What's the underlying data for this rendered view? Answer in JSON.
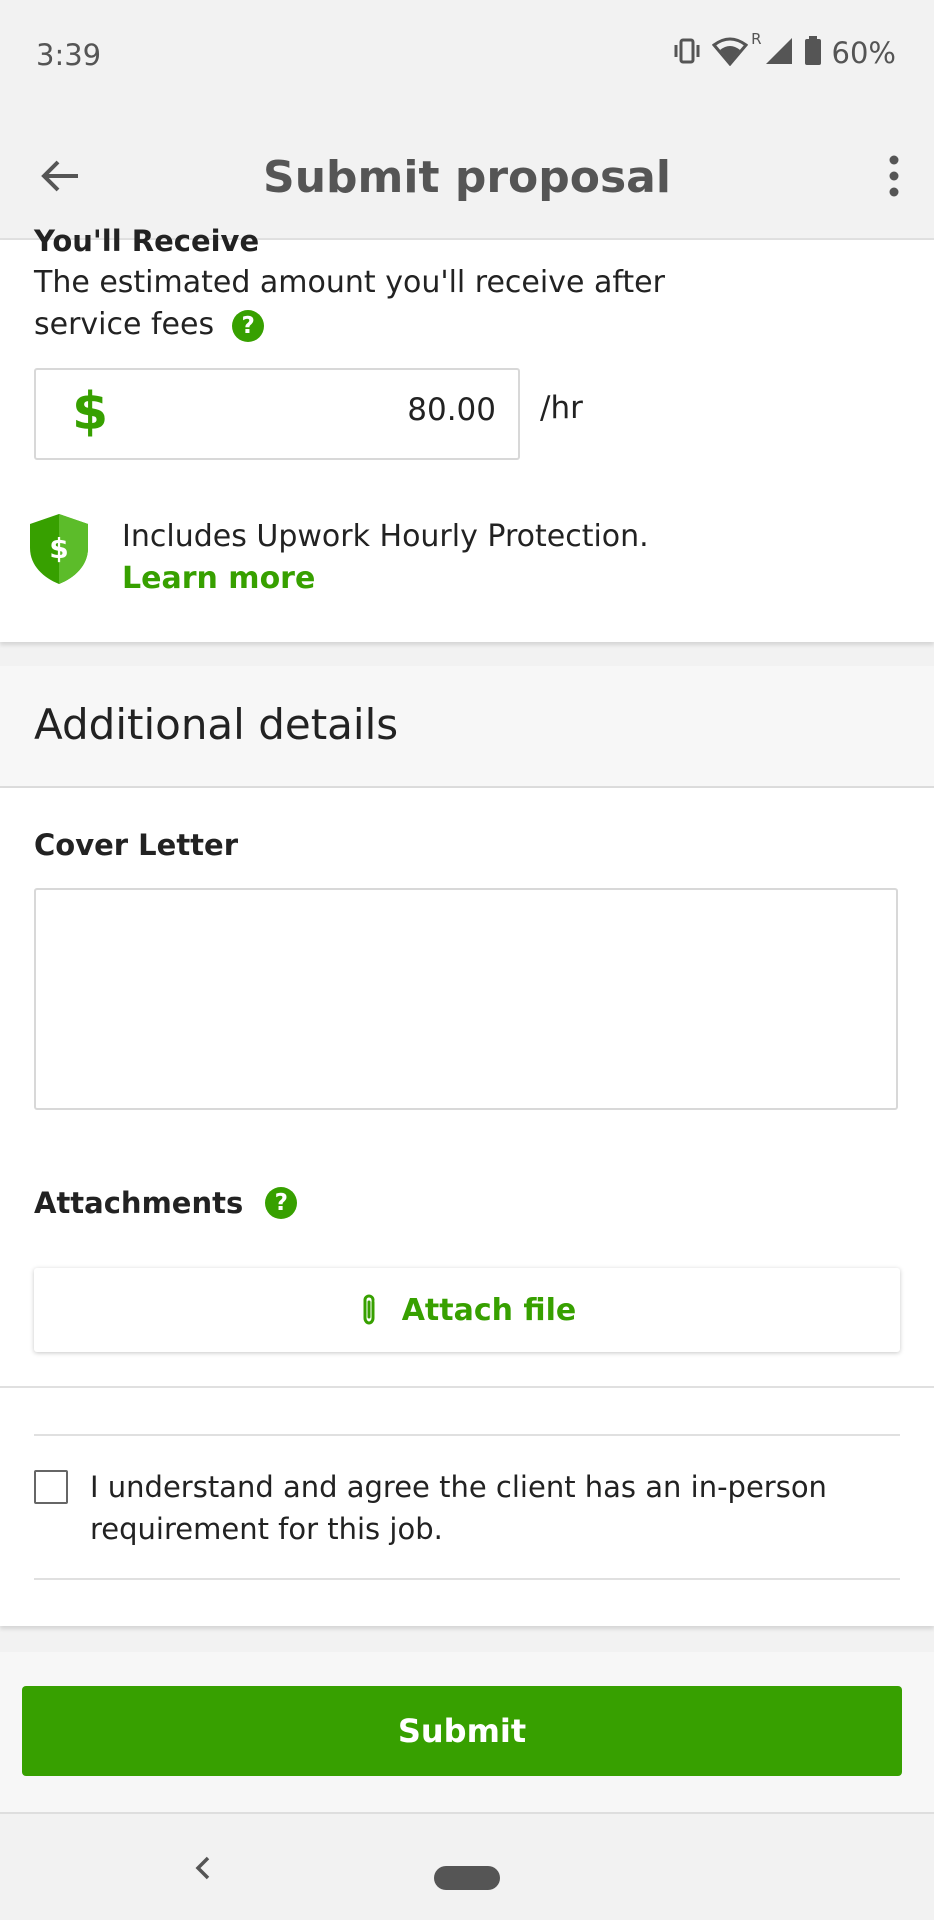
{
  "status_bar": {
    "time": "3:39",
    "roaming_indicator": "R",
    "battery": "60%",
    "icons": [
      "vibrate-icon",
      "wifi-icon",
      "signal-icon",
      "battery-icon"
    ]
  },
  "app_bar": {
    "title": "Submit proposal",
    "back_icon": "arrow-left-icon",
    "menu_icon": "more-vert-icon"
  },
  "receive": {
    "title": "You'll Receive",
    "description": "The estimated amount you'll receive after service fees",
    "help": "?",
    "currency_symbol": "$",
    "amount": "80.00",
    "unit": "/hr"
  },
  "protection": {
    "text": "Includes Upwork Hourly Protection.",
    "learn_more": "Learn more",
    "shield_symbol": "$"
  },
  "additional_details": {
    "title": "Additional details",
    "cover_letter_label": "Cover Letter",
    "cover_letter_value": "",
    "attachments_label": "Attachments",
    "attachments_help": "?",
    "attach_button": "Attach file",
    "agreement_text": " I understand and agree the client has an in-person requirement for this job.",
    "agreement_checked": false
  },
  "submit": {
    "label": "Submit"
  },
  "colors": {
    "accent": "#37a000",
    "background": "#f2f2f2",
    "text": "#222222"
  }
}
